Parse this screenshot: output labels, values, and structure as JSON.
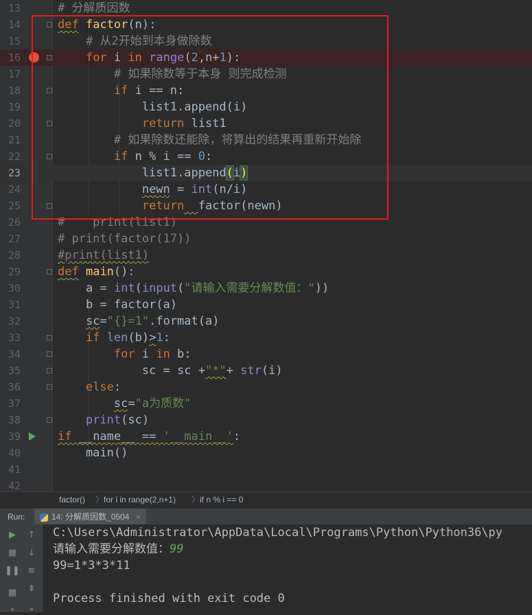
{
  "editor": {
    "lines": [
      {
        "num": "13"
      },
      {
        "num": "14"
      },
      {
        "num": "15"
      },
      {
        "num": "16"
      },
      {
        "num": "17"
      },
      {
        "num": "18"
      },
      {
        "num": "19"
      },
      {
        "num": "20"
      },
      {
        "num": "21"
      },
      {
        "num": "22"
      },
      {
        "num": "23"
      },
      {
        "num": "24"
      },
      {
        "num": "25"
      },
      {
        "num": "26"
      },
      {
        "num": "27"
      },
      {
        "num": "28"
      },
      {
        "num": "29"
      },
      {
        "num": "30"
      },
      {
        "num": "31"
      },
      {
        "num": "32"
      },
      {
        "num": "33"
      },
      {
        "num": "34"
      },
      {
        "num": "35"
      },
      {
        "num": "36"
      },
      {
        "num": "37"
      },
      {
        "num": "38"
      },
      {
        "num": "39"
      },
      {
        "num": "40"
      },
      {
        "num": "41"
      },
      {
        "num": "42"
      }
    ],
    "code": {
      "l13": "# 分解质因数",
      "l15": "# 从2开始到本身做除数",
      "l17": "# 如果除数等于本身 则完成检测",
      "l21": "# 如果除数还能除，将算出的结果再重新开始除",
      "l26": "#    print(list1)",
      "l27": "# print(factor(17))",
      "l28": "#print(list1)",
      "prompt_str": "\"请输入需要分解数值：\"",
      "fmt_str": "\"{}=1\"",
      "star_str": "\"*\"",
      "prime_str": "\"a为质数\"",
      "main_str": "'__main__'"
    },
    "current_line": "23",
    "breakpoint_line": "16",
    "highlight_color": "#e51e1e"
  },
  "breadcrumbs": [
    "factor()",
    "for i in range(2,n+1)",
    "if n % i == 0"
  ],
  "run_panel": {
    "label": "Run:",
    "tab_label": "14: 分解质因数_0504",
    "close": "×"
  },
  "console": {
    "path_line": "C:\\Users\\Administrator\\AppData\\Local\\Programs\\Python\\Python36\\py",
    "prompt": "请输入需要分解数值：",
    "user_input": "99",
    "result": "99=1*3*3*11",
    "exit_message": "Process finished with exit code 0"
  },
  "icons": [
    "run-icon",
    "stop-icon",
    "pause-icon",
    "layout-icon",
    "scroll-up-icon",
    "scroll-down-icon",
    "soft-wrap-icon",
    "sort-icon",
    "more-icon",
    "breakpoint-icon",
    "run-gutter-icon",
    "python-file-icon"
  ]
}
